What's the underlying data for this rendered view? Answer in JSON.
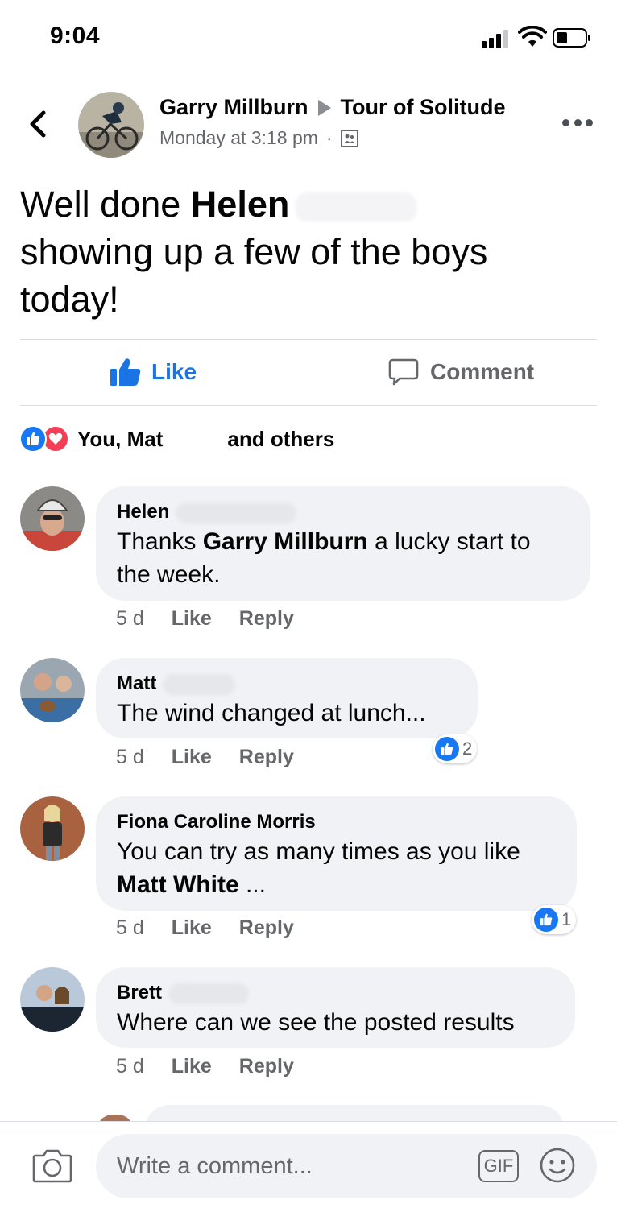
{
  "status_bar": {
    "time": "9:04"
  },
  "post": {
    "author": "Garry Millburn",
    "group": "Tour of Solitude",
    "timestamp": "Monday at 3:18 pm",
    "separator": "·",
    "text_part1": "Well done ",
    "text_mention": "Helen",
    "text_part2": "showing up a few of the boys today!"
  },
  "actions": {
    "like_label": "Like",
    "comment_label": "Comment"
  },
  "reactions_summary": {
    "text1": "You, Mat",
    "text2": "and others"
  },
  "comments": [
    {
      "name": "Helen",
      "body_part1": "Thanks ",
      "body_mention": "Garry Millburn",
      "body_part2": " a lucky start to the week.",
      "time": "5 d",
      "like": "Like",
      "reply": "Reply"
    },
    {
      "name": "Matt",
      "body": "The wind changed at lunch...",
      "time": "5 d",
      "like": "Like",
      "reply": "Reply",
      "reaction_count": "2"
    },
    {
      "name": "Fiona Caroline Morris",
      "body_part1": "You can try as many times as you like ",
      "body_mention": "Matt White",
      "body_part2": " ...",
      "time": "5 d",
      "like": "Like",
      "reply": "Reply",
      "reaction_count": "1"
    },
    {
      "name": "Brett",
      "body": "Where can we see the posted results",
      "time": "5 d",
      "like": "Like",
      "reply": "Reply"
    }
  ],
  "composer": {
    "placeholder": "Write a comment...",
    "gif_label": "GIF"
  },
  "colors": {
    "accent": "#1877f2",
    "like_text": "#1b74e4",
    "love": "#f33e58",
    "bubble_bg": "#f0f2f5",
    "secondary_text": "#65676b"
  },
  "icons": [
    "signal-icon",
    "wifi-icon",
    "battery-icon",
    "back-chevron-icon",
    "triangle-icon",
    "group-icon",
    "more-icon",
    "like-thumb-icon",
    "comment-icon",
    "love-reaction-icon",
    "camera-icon",
    "gif-icon",
    "emoji-icon"
  ]
}
